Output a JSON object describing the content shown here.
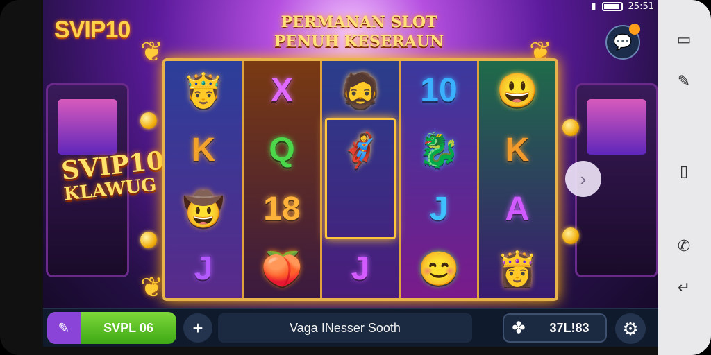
{
  "status_bar": {
    "time": "25:51"
  },
  "header": {
    "logo": "SVIP10",
    "banner_line1": "PERMANAN SLOT",
    "banner_line2": "PENUH KESERAUN"
  },
  "side_promo": {
    "line1": "SVIP10",
    "line2": "KLAWUG"
  },
  "reels": [
    [
      {
        "sym": "viking",
        "glyph": "🤴",
        "color": "#f5c15a"
      },
      {
        "sym": "K",
        "glyph": "K",
        "color": "#f2a22a"
      },
      {
        "sym": "cowboy",
        "glyph": "🤠",
        "color": "#e0a04a"
      },
      {
        "sym": "J",
        "glyph": "J",
        "color": "#b35aff"
      }
    ],
    [
      {
        "sym": "X",
        "glyph": "X",
        "color": "#e06aff"
      },
      {
        "sym": "Q",
        "glyph": "Q",
        "color": "#4cd64a"
      },
      {
        "sym": "18",
        "glyph": "18",
        "color": "#ffb23a"
      },
      {
        "sym": "peach",
        "glyph": "🍑",
        "color": "#ff8a1a"
      }
    ],
    [
      {
        "sym": "viking",
        "glyph": "🧔",
        "color": "#f5c15a"
      },
      {
        "sym": "hero",
        "glyph": "🦸",
        "color": "#ffd36a"
      },
      {
        "sym": "hero2",
        "glyph": "",
        "color": "#ffd36a"
      },
      {
        "sym": "J",
        "glyph": "J",
        "color": "#d35aff"
      }
    ],
    [
      {
        "sym": "10",
        "glyph": "10",
        "color": "#3ab0ff"
      },
      {
        "sym": "dragon",
        "glyph": "🐉",
        "color": "#4ac0ff"
      },
      {
        "sym": "J",
        "glyph": "J",
        "color": "#3fc0ff"
      },
      {
        "sym": "smile",
        "glyph": "😊",
        "color": "#5ad64a"
      }
    ],
    [
      {
        "sym": "sun",
        "glyph": "😃",
        "color": "#ffd23a"
      },
      {
        "sym": "K",
        "glyph": "K",
        "color": "#f29a2a"
      },
      {
        "sym": "A",
        "glyph": "A",
        "color": "#d05aff"
      },
      {
        "sym": "viking",
        "glyph": "👸",
        "color": "#ffb24a"
      }
    ]
  ],
  "bottom_bar": {
    "bet_label": "SVPL 06",
    "message": "Vaga INesser Sooth",
    "credit": "37L!83"
  }
}
